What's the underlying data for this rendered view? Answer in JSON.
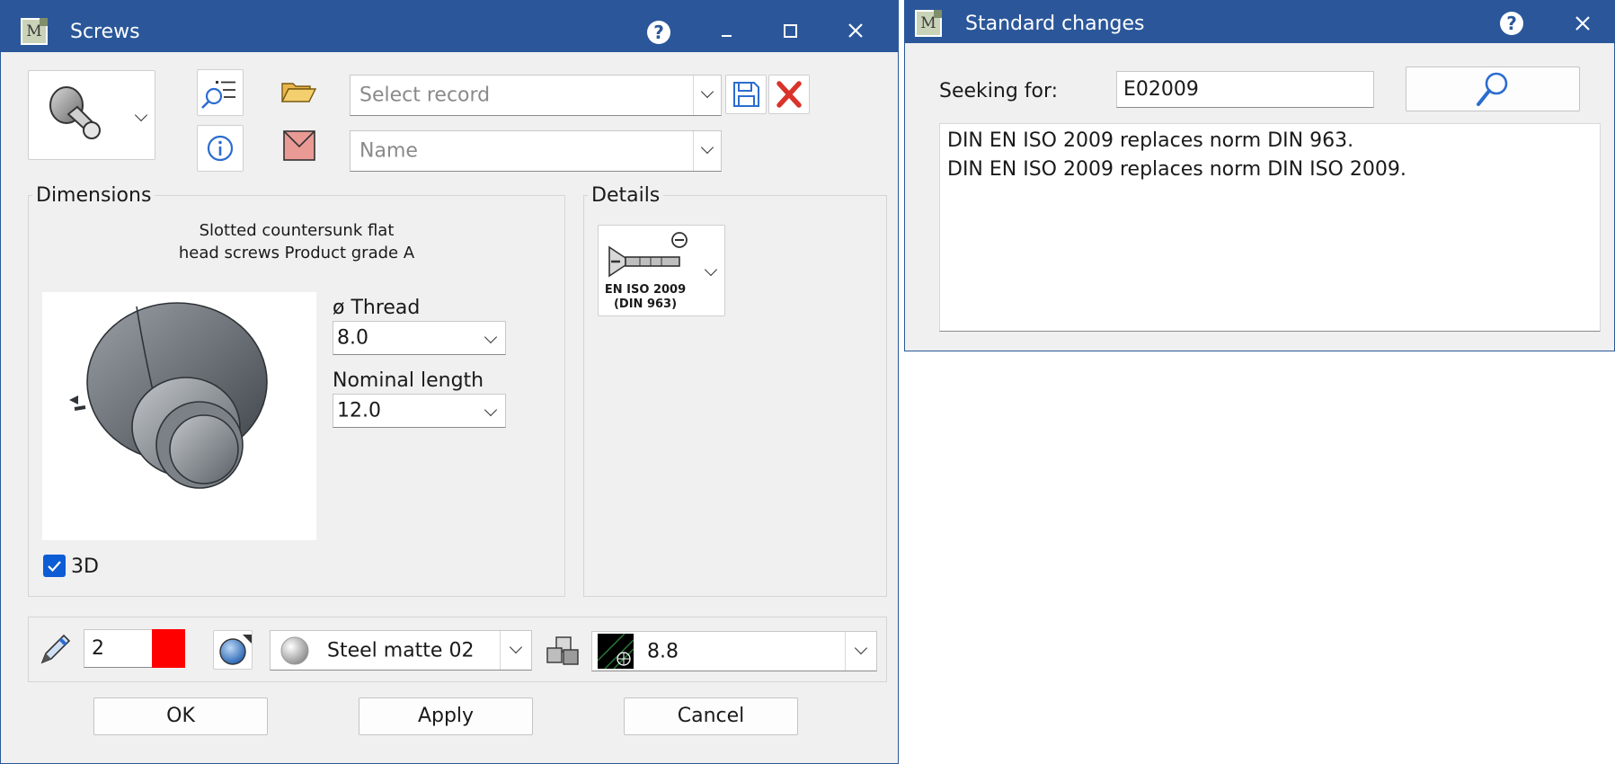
{
  "screws_window": {
    "title": "Screws",
    "app_icon_letter": "M",
    "help_label": "?",
    "record_select": {
      "placeholder": "Select record"
    },
    "name_select": {
      "placeholder": "Name"
    },
    "dimensions": {
      "group_label": "Dimensions",
      "description_line1": "Slotted countersunk flat",
      "description_line2": "head screws Product grade A",
      "thread_label": "ø Thread",
      "thread_value": "8.0",
      "length_label": "Nominal length",
      "length_value": "12.0",
      "checkbox_3d_label": "3D",
      "checkbox_3d_checked": true
    },
    "details": {
      "group_label": "Details",
      "standard_line1": "EN ISO 2009",
      "standard_line2": "(DIN 963)"
    },
    "bottom_bar": {
      "line_width_value": "2",
      "line_color": "#ff0000",
      "material_value": "Steel matte 02",
      "grade_value": "8.8"
    },
    "buttons": {
      "ok": "OK",
      "apply": "Apply",
      "cancel": "Cancel"
    }
  },
  "standard_window": {
    "title": "Standard changes",
    "app_icon_letter": "M",
    "help_label": "?",
    "seeking_label": "Seeking for:",
    "seeking_value": "E02009",
    "results": [
      "DIN EN ISO 2009 replaces norm DIN 963.",
      "DIN EN ISO 2009 replaces norm DIN ISO 2009."
    ]
  },
  "colors": {
    "titlebar": "#2b579a",
    "window_bg": "#f0f0f0",
    "accent": "#0b5cd5"
  }
}
